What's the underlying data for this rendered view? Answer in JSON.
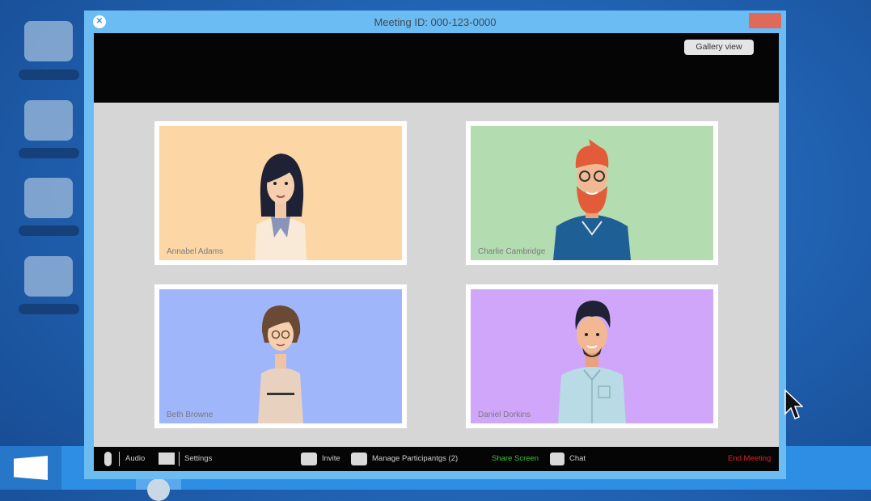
{
  "window": {
    "title": "Meeting ID: 000-123-0000",
    "gallery_view_label": "Gallery view"
  },
  "participants": [
    {
      "name": "Annabel Adams",
      "bg": "#fdd6a5"
    },
    {
      "name": "Charlie Cambridge",
      "bg": "#b3ddb0"
    },
    {
      "name": "Beth Browne",
      "bg": "#9fb6fb"
    },
    {
      "name": "Daniel Dorkins",
      "bg": "#d0a6fa"
    }
  ],
  "controls": {
    "audio": "Audio",
    "settings": "Settings",
    "invite": "Invite",
    "manage_participants": "Manage Participantgs (2)",
    "share_screen": "Share Screen",
    "chat": "Chat",
    "end_meeting": "End Meeting"
  },
  "colors": {
    "share_screen": "#39c43a",
    "end_meeting": "#e0202a",
    "close_button": "#e06a5a"
  }
}
